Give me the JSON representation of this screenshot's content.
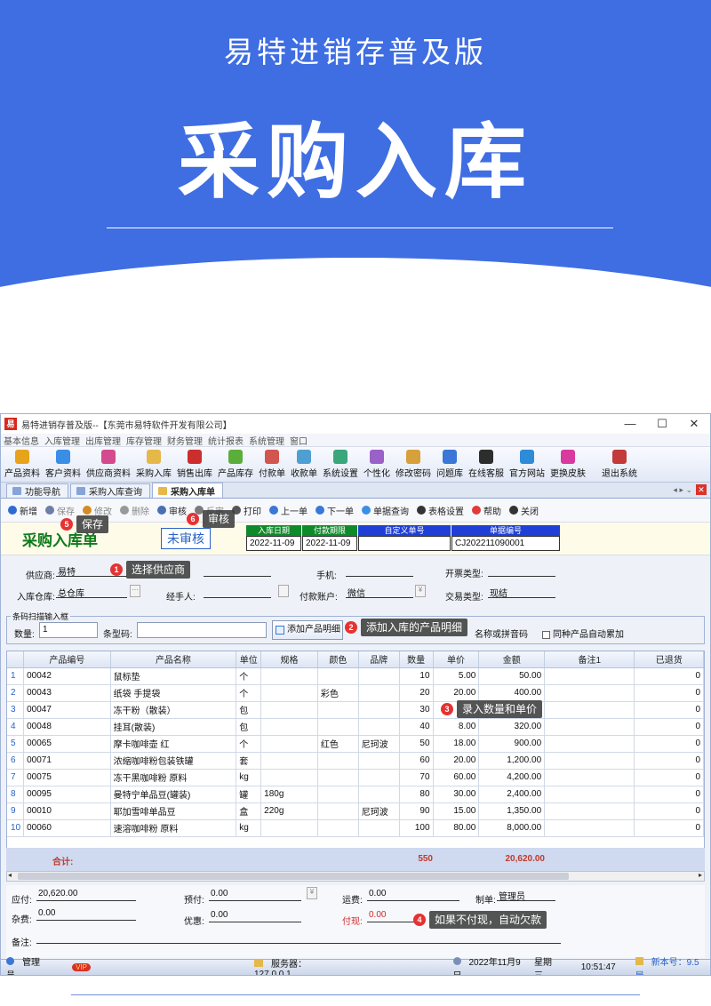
{
  "hero": {
    "subtitle": "易特进销存普及版",
    "title": "采购入库"
  },
  "window": {
    "app_icon": "易",
    "title": "易特进销存普及版--【东莞市易特软件开发有限公司】",
    "controls": [
      "—",
      "☐",
      "✕"
    ],
    "menu": [
      "基本信息",
      "入库管理",
      "出库管理",
      "库存管理",
      "财务管理",
      "统计报表",
      "系统管理",
      "窗口"
    ],
    "toolbar": [
      {
        "label": "产品资料",
        "color": "#e8a31c"
      },
      {
        "label": "客户资料",
        "color": "#3a8ee6"
      },
      {
        "label": "供应商资料",
        "color": "#d34a8f"
      },
      {
        "label": "采购入库",
        "color": "#e6b84a"
      },
      {
        "label": "销售出库",
        "color": "#cc2e2e"
      },
      {
        "label": "产品库存",
        "color": "#5cae3a"
      },
      {
        "label": "付款单",
        "color": "#d2554f"
      },
      {
        "label": "收款单",
        "color": "#4f9fd2"
      },
      {
        "label": "系统设置",
        "color": "#3aa67b"
      },
      {
        "label": "个性化",
        "color": "#9a62c8"
      },
      {
        "label": "修改密码",
        "color": "#d6a03a"
      },
      {
        "label": "问题库",
        "color": "#3a77d6"
      },
      {
        "label": "在线客服",
        "color": "#2d2d2d"
      },
      {
        "label": "官方网站",
        "color": "#2e8bd8"
      },
      {
        "label": "更换皮肤",
        "color": "#d83a9e"
      },
      {
        "label": "退出系统",
        "color": "#c23a3a"
      }
    ],
    "tabs": [
      "功能导航",
      "采购入库查询",
      "采购入库单"
    ],
    "tab_controls": "◂ ▸ ⌄",
    "close_tab": "✕"
  },
  "actions": [
    {
      "label": "新增",
      "icon": "plus-icon",
      "color": "#2d6bd3",
      "disabled": false
    },
    {
      "label": "保存",
      "icon": "save-icon",
      "color": "#6c7fa8",
      "disabled": true
    },
    {
      "label": "修改",
      "icon": "edit-icon",
      "color": "#d58b22",
      "disabled": true
    },
    {
      "label": "删除",
      "icon": "delete-icon",
      "color": "#999999",
      "disabled": true
    },
    {
      "label": "审核",
      "icon": "audit-icon",
      "color": "#4a6fb3",
      "disabled": false
    },
    {
      "label": "反审",
      "icon": "unaudit-icon",
      "color": "#7a7a7a",
      "disabled": true
    },
    {
      "label": "打印",
      "icon": "print-icon",
      "color": "#555555",
      "disabled": false
    },
    {
      "label": "上一单",
      "icon": "prev-icon",
      "color": "#3a77d6",
      "disabled": false
    },
    {
      "label": "下一单",
      "icon": "next-icon",
      "color": "#3a77d6",
      "disabled": false
    },
    {
      "label": "单据查询",
      "icon": "query-icon",
      "color": "#3a8ee6",
      "disabled": false
    },
    {
      "label": "表格设置",
      "icon": "table-icon",
      "color": "#333333",
      "disabled": false
    },
    {
      "label": "帮助",
      "icon": "help-icon",
      "color": "#e03a3a",
      "disabled": false
    },
    {
      "label": "关闭",
      "icon": "close-icon",
      "color": "#333333",
      "disabled": false
    }
  ],
  "header": {
    "title": "采购入库单",
    "status": "未审核",
    "cols": [
      {
        "label": "入库日期",
        "value": "2022-11-09",
        "color": "#0f8a2a"
      },
      {
        "label": "付款期限",
        "value": "2022-11-09",
        "color": "#0f8a2a"
      },
      {
        "label": "自定义单号",
        "value": "",
        "color": "#1f3fd6"
      },
      {
        "label": "单据编号",
        "value": "CJ202211090001",
        "color": "#1f3fd6"
      }
    ]
  },
  "fields": {
    "supplier_label": "供应商:",
    "supplier": "易特",
    "phone_label": "手机:",
    "phone": "",
    "invoice_label": "开票类型:",
    "invoice": "",
    "warehouse_label": "入库仓库:",
    "warehouse": "总仓库",
    "handler_label": "经手人:",
    "handler": "",
    "account_label": "付款账户:",
    "account": "微信",
    "trade_label": "交易类型:",
    "trade": "现结"
  },
  "scan": {
    "legend": "条码扫描输入框",
    "qty_label": "数量:",
    "qty": "1",
    "barcode_label": "条型码:",
    "barcode": "",
    "add_button": "添加产品明细",
    "hint": "名称或拼音码",
    "auto_label": "同种产品自动累加"
  },
  "grid": {
    "columns": [
      "",
      "产品编号",
      "产品名称",
      "单位",
      "规格",
      "颜色",
      "品牌",
      "数量",
      "单价",
      "金额",
      "备注1",
      "已退货"
    ],
    "rows": [
      [
        "1",
        "00042",
        "鼠标垫",
        "个",
        "",
        "",
        "",
        "10",
        "5.00",
        "50.00",
        "",
        "0"
      ],
      [
        "2",
        "00043",
        "纸袋 手提袋",
        "个",
        "",
        "彩色",
        "",
        "20",
        "20.00",
        "400.00",
        "",
        "0"
      ],
      [
        "3",
        "00047",
        "冻干粉（散装）",
        "包",
        "",
        "",
        "",
        "30",
        "",
        "",
        "",
        "0"
      ],
      [
        "4",
        "00048",
        "挂耳(散装)",
        "包",
        "",
        "",
        "",
        "40",
        "8.00",
        "320.00",
        "",
        "0"
      ],
      [
        "5",
        "00065",
        "摩卡咖啡壶 红",
        "个",
        "",
        "红色",
        "尼珂波",
        "50",
        "18.00",
        "900.00",
        "",
        "0"
      ],
      [
        "6",
        "00071",
        "浓缩咖啡粉包装铁罐",
        "套",
        "",
        "",
        "",
        "60",
        "20.00",
        "1,200.00",
        "",
        "0"
      ],
      [
        "7",
        "00075",
        "冻干黑咖啡粉 原料",
        "kg",
        "",
        "",
        "",
        "70",
        "60.00",
        "4,200.00",
        "",
        "0"
      ],
      [
        "8",
        "00095",
        "曼特宁单品豆(罐装)",
        "罐",
        "180g",
        "",
        "",
        "80",
        "30.00",
        "2,400.00",
        "",
        "0"
      ],
      [
        "9",
        "00010",
        "耶加雪啡单品豆",
        "盒",
        "220g",
        "",
        "尼珂波",
        "90",
        "15.00",
        "1,350.00",
        "",
        "0"
      ],
      [
        "10",
        "00060",
        "速溶咖啡粉 原料",
        "kg",
        "",
        "",
        "",
        "100",
        "80.00",
        "8,000.00",
        "",
        "0"
      ]
    ],
    "total_label": "合计:",
    "total_qty": "550",
    "total_amount": "20,620.00"
  },
  "footer": {
    "payable_label": "应付:",
    "payable": "20,620.00",
    "prepaid_label": "预付:",
    "prepaid": "0.00",
    "freight_label": "运费:",
    "freight": "0.00",
    "maker_label": "制单:",
    "maker": "管理员",
    "misc_label": "杂费:",
    "misc": "0.00",
    "discount_label": "优惠:",
    "discount": "0.00",
    "cash_label": "付现:",
    "cash": "0.00",
    "note_label": "备注:",
    "note": ""
  },
  "status": {
    "user": "管理员",
    "badge": "VIP",
    "server": "服务器：127.0.0.1",
    "date": "2022年11月9日",
    "weekday": "星期三",
    "time": "10:51:47",
    "version": "新本号：9.5 局"
  },
  "callouts": [
    {
      "n": "5",
      "text": "保存"
    },
    {
      "n": "6",
      "text": "审核"
    },
    {
      "n": "1",
      "text": "选择供应商"
    },
    {
      "n": "2",
      "text": "添加入库的产品明细"
    },
    {
      "n": "3",
      "text": "录入数量和单价"
    },
    {
      "n": "4",
      "text": "如果不付现，自动欠款"
    }
  ]
}
